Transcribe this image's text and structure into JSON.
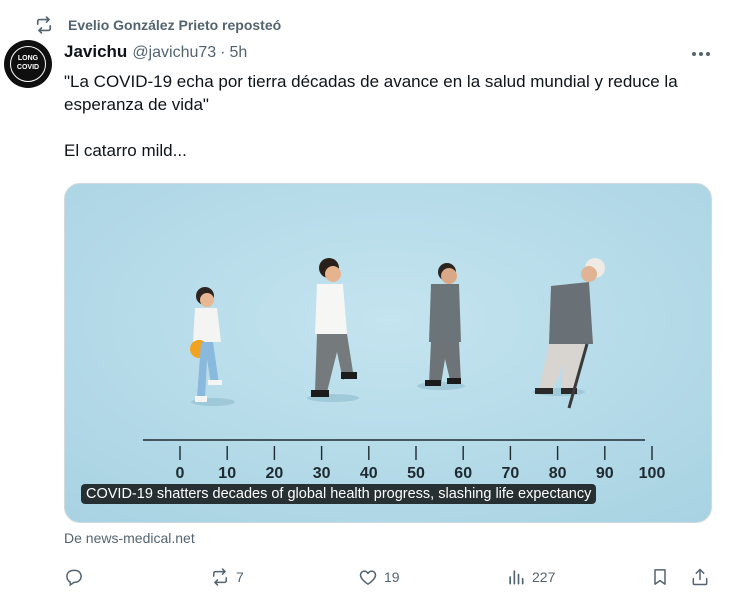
{
  "repost": {
    "icon": "repost-icon",
    "text": "Evelio González Prieto reposteó"
  },
  "author": {
    "name": "Javichu",
    "handle": "@javichu73",
    "separator": "·",
    "time": "5h",
    "avatar_line1": "LONG",
    "avatar_line2": "COVID"
  },
  "tweet": {
    "line1": "\"La COVID-19 echa por tierra décadas de avance en la salud mundial y reduce la esperanza de vida\"",
    "line2": "El catarro mild..."
  },
  "media": {
    "caption": "COVID-19 shatters decades of global health progress, slashing life expectancy",
    "ruler_labels": [
      "0",
      "10",
      "20",
      "30",
      "40",
      "50",
      "60",
      "70",
      "80",
      "90",
      "100"
    ]
  },
  "source": "De news-medical.net",
  "actions": {
    "reply": {
      "icon": "reply-icon",
      "count": ""
    },
    "retweet": {
      "icon": "retweet-icon",
      "count": "7"
    },
    "like": {
      "icon": "heart-icon",
      "count": "19"
    },
    "views": {
      "icon": "views-icon",
      "count": "227"
    },
    "bookmark": {
      "icon": "bookmark-icon"
    },
    "share": {
      "icon": "share-icon"
    }
  },
  "colors": {
    "text": "#0f1419",
    "secondary": "#536471",
    "border": "#cfd9de",
    "image_bg": "#b6dbe8"
  }
}
